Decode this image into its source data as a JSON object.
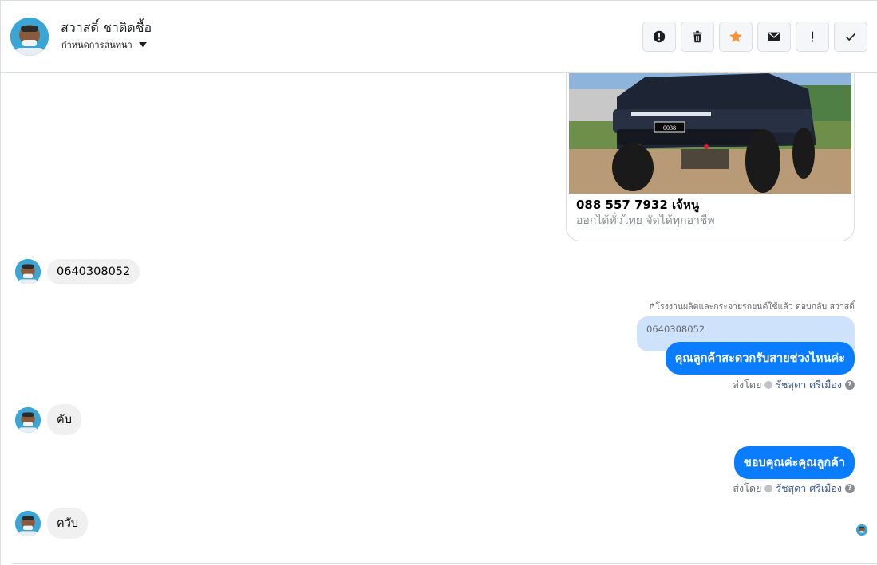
{
  "header": {
    "contact_name": "สวาสดิ์ ชาติดชื้อ",
    "subtitle": "กำหนดการสนทนา"
  },
  "toolbar": {
    "buttons": [
      {
        "icon": "alert-circle-icon"
      },
      {
        "icon": "trash-icon"
      },
      {
        "icon": "star-icon",
        "color": "#f7923a"
      },
      {
        "icon": "envelope-icon"
      },
      {
        "icon": "exclamation-icon"
      },
      {
        "icon": "check-icon"
      }
    ]
  },
  "card": {
    "title": "088 557 7932 เจ้หนู",
    "subtitle": "ออกได้ทั่วไทย จัดได้ทุกอาชีพ",
    "plate": "0038"
  },
  "messages": {
    "msg1": "0640308052",
    "reply_note": "โรงงานผลิตและกระจายรถยนต์ใช้แล้ว ตอบกลับ สวาสดิ์",
    "quoted_text": "0640308052",
    "out1": "คุณลูกค้าสะดวกรับสายช่วงไหนค่ะ",
    "sent_by_label": "ส่งโดย",
    "agent_name": "รัชสุดา ศรีเมือง",
    "msg2": "คับ",
    "out2": "ขอบคุณค่ะคุณลูกค้า",
    "msg3": "ควับ"
  },
  "colors": {
    "outgoing_bubble": "#0a7cff",
    "incoming_bubble": "#f0f0f0",
    "quoted_bubble": "#cfe2fb"
  }
}
